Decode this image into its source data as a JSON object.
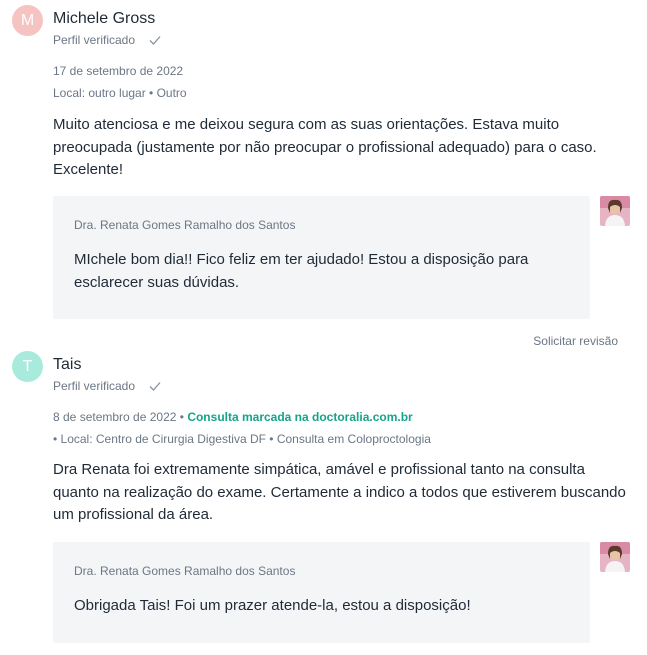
{
  "reviews": [
    {
      "avatar_letter": "M",
      "avatar_color": "#f6c3c3",
      "author": "Michele Gross",
      "verified": "Perfil verificado",
      "date": "17 de setembro de 2022",
      "location": "Local: outro lugar • Outro",
      "text": "Muito atenciosa e me deixou segura com as suas orientações. Estava muito preocupada (justamente por não preocupar o profissional adequado) para o caso. Excelente!",
      "reply": {
        "author": "Dra. Renata Gomes Ramalho dos Santos",
        "text": "MIchele bom dia!! Fico feliz em ter ajudado! Estou a disposição para esclarecer suas dúvidas."
      },
      "request_review": "Solicitar revisão"
    },
    {
      "avatar_letter": "T",
      "avatar_color": "#a8ebdc",
      "author": "Tais",
      "verified": "Perfil verificado",
      "date": "8 de setembro de 2022 •",
      "booking_link": "Consulta marcada na doctoralia.com.br",
      "location": "• Local: Centro de Cirurgia Digestiva DF • Consulta em Coloproctologia",
      "text": "Dra Renata foi extremamente simpática, amável e profissional tanto na consulta quanto na realização do exame. Certamente a indico a todos que estiverem buscando um profissional da área.",
      "reply": {
        "author": "Dra. Renata Gomes Ramalho dos Santos",
        "text": "Obrigada Tais! Foi um prazer atende-la, estou a disposição!"
      }
    }
  ]
}
